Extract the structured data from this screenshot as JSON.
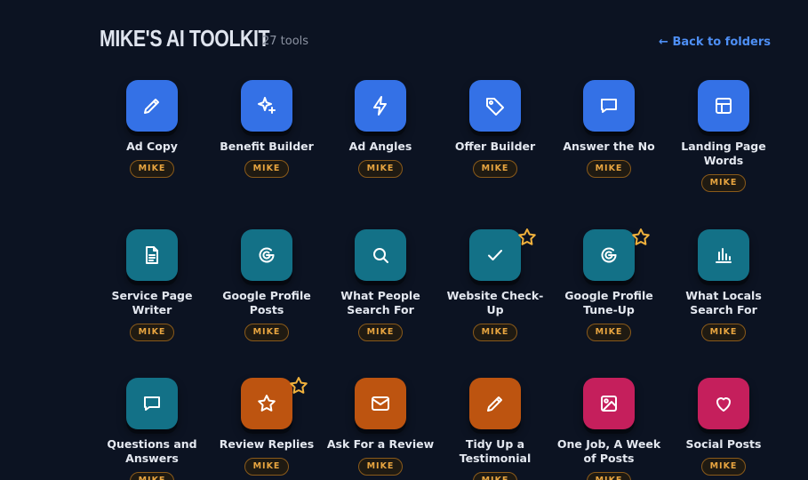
{
  "header": {
    "title": "MIKE'S AI TOOLKIT",
    "count": "27 tools",
    "back_link": "← Back to folders"
  },
  "colors": {
    "blue": "#3471e6",
    "teal": "#137187",
    "orange": "#bd5410",
    "pink": "#c51f5c",
    "badge_text": "#e8a540",
    "star": "#f0b13c"
  },
  "tools": [
    {
      "label": "Ad Copy",
      "badge": "MIKE",
      "icon": "pencil-icon",
      "color": "blue",
      "starred": false
    },
    {
      "label": "Benefit Builder",
      "badge": "MIKE",
      "icon": "sparkles-icon",
      "color": "blue",
      "starred": false
    },
    {
      "label": "Ad Angles",
      "badge": "MIKE",
      "icon": "lightning-icon",
      "color": "blue",
      "starred": false
    },
    {
      "label": "Offer Builder",
      "badge": "MIKE",
      "icon": "tag-icon",
      "color": "blue",
      "starred": false
    },
    {
      "label": "Answer the No",
      "badge": "MIKE",
      "icon": "chat-bubble-icon",
      "color": "blue",
      "starred": false
    },
    {
      "label": "Landing Page Words",
      "badge": "MIKE",
      "icon": "layout-icon",
      "color": "blue",
      "starred": false
    },
    {
      "label": "Service Page Writer",
      "badge": "MIKE",
      "icon": "document-icon",
      "color": "teal",
      "starred": false
    },
    {
      "label": "Google Profile Posts",
      "badge": "MIKE",
      "icon": "google-icon",
      "color": "teal",
      "starred": false
    },
    {
      "label": "What People Search For",
      "badge": "MIKE",
      "icon": "search-icon",
      "color": "teal",
      "starred": false
    },
    {
      "label": "Website Check-Up",
      "badge": "MIKE",
      "icon": "checkmark-icon",
      "color": "teal",
      "starred": true
    },
    {
      "label": "Google Profile Tune-Up",
      "badge": "MIKE",
      "icon": "google-icon",
      "color": "teal",
      "starred": true
    },
    {
      "label": "What Locals Search For",
      "badge": "MIKE",
      "icon": "bar-chart-icon",
      "color": "teal",
      "starred": false
    },
    {
      "label": "Questions and Answers",
      "badge": "MIKE",
      "icon": "chat-bubble-icon",
      "color": "teal",
      "starred": false
    },
    {
      "label": "Review Replies",
      "badge": "MIKE",
      "icon": "star-icon",
      "color": "orange",
      "starred": true
    },
    {
      "label": "Ask For a Review",
      "badge": "MIKE",
      "icon": "envelope-icon",
      "color": "orange",
      "starred": false
    },
    {
      "label": "Tidy Up a Testimonial",
      "badge": "MIKE",
      "icon": "pencil-icon",
      "color": "orange",
      "starred": false
    },
    {
      "label": "One Job, A Week of Posts",
      "badge": "MIKE",
      "icon": "image-icon",
      "color": "pink",
      "starred": false
    },
    {
      "label": "Social Posts",
      "badge": "MIKE",
      "icon": "heart-icon",
      "color": "pink",
      "starred": false
    }
  ]
}
